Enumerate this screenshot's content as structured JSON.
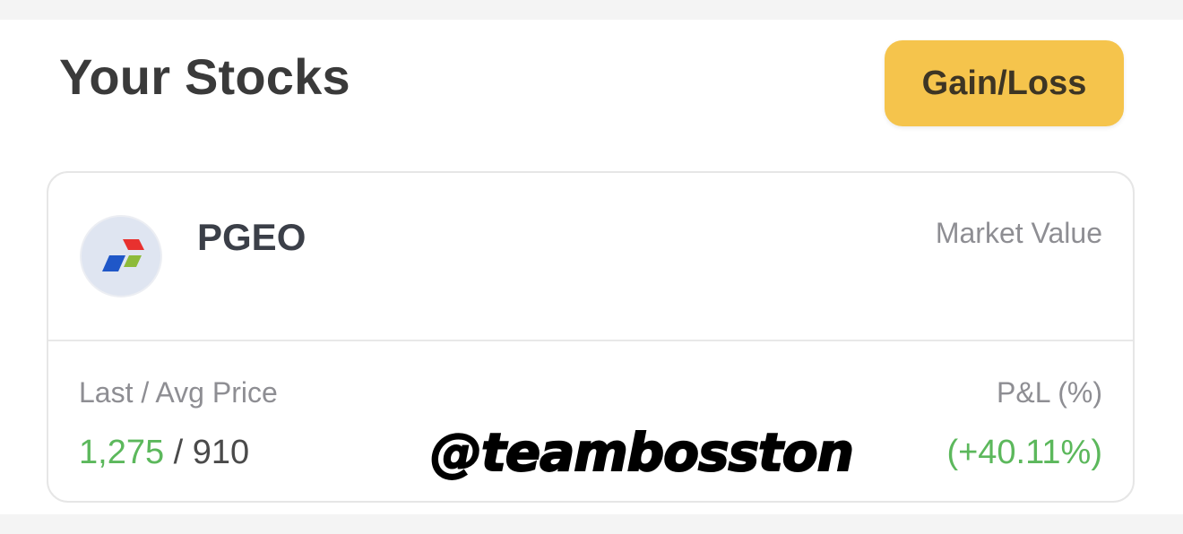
{
  "header": {
    "title": "Your Stocks",
    "gain_loss_label": "Gain/Loss"
  },
  "stock": {
    "ticker": "PGEO",
    "logo_icon": "pertamina-logo-icon",
    "market_value_label": "Market Value",
    "market_value": "",
    "last_avg_label": "Last / Avg Price",
    "last_price": "1,275",
    "separator": " / ",
    "avg_price": "910",
    "pl_label": "P&L (%)",
    "pl_value": "(+40.11%)"
  },
  "watermark": "@teambosston",
  "colors": {
    "accent_button": "#f5c44c",
    "positive": "#5cb85c",
    "logo_red": "#e8312f",
    "logo_blue": "#1f57c8",
    "logo_green": "#8dbb3a"
  }
}
